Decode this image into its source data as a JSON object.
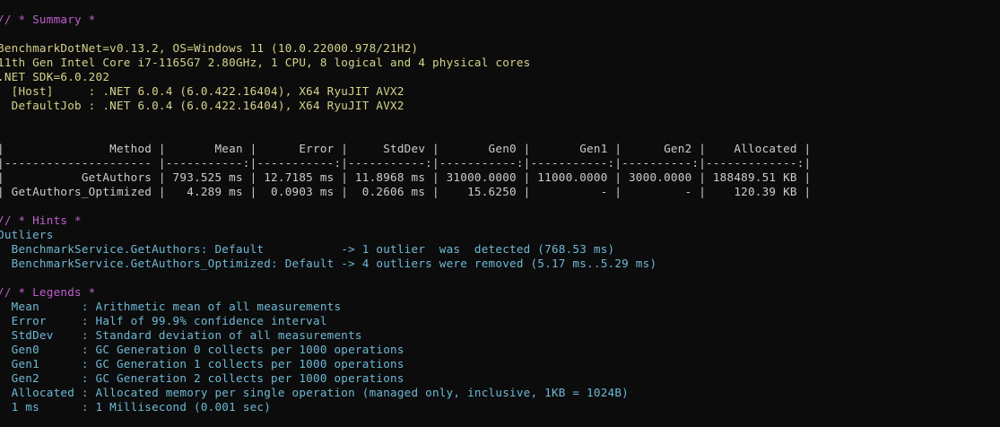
{
  "summary_header": "// * Summary *",
  "environment": {
    "line1": "BenchmarkDotNet=v0.13.2, OS=Windows 11 (10.0.22000.978/21H2)",
    "line2": "11th Gen Intel Core i7-1165G7 2.80GHz, 1 CPU, 8 logical and 4 physical cores",
    "line3": ".NET SDK=6.0.202",
    "line4": "  [Host]     : .NET 6.0.4 (6.0.422.16404), X64 RyuJIT AVX2",
    "line5": "  DefaultJob : .NET 6.0.4 (6.0.422.16404), X64 RyuJIT AVX2"
  },
  "results_table": {
    "header_row": "|               Method |       Mean |      Error |     StdDev |       Gen0 |       Gen1 |      Gen2 |    Allocated |",
    "separator_row": "|--------------------- |-----------:|-----------:|-----------:|-----------:|-----------:|----------:|-------------:|",
    "columns": [
      "Method",
      "Mean",
      "Error",
      "StdDev",
      "Gen0",
      "Gen1",
      "Gen2",
      "Allocated"
    ],
    "rows": [
      {
        "method": "GetAuthors",
        "mean": "793.525 ms",
        "error": "12.7185 ms",
        "stddev": "11.8968 ms",
        "gen0": "31000.0000",
        "gen1": "11000.0000",
        "gen2": "3000.0000",
        "allocated": "188489.51 KB",
        "text": "|           GetAuthors | 793.525 ms | 12.7185 ms | 11.8968 ms | 31000.0000 | 11000.0000 | 3000.0000 | 188489.51 KB |"
      },
      {
        "method": "GetAuthors_Optimized",
        "mean": "4.289 ms",
        "error": "0.0903 ms",
        "stddev": "0.2606 ms",
        "gen0": "15.6250",
        "gen1": "-",
        "gen2": "-",
        "allocated": "120.39 KB",
        "text": "| GetAuthors_Optimized |   4.289 ms |  0.0903 ms |  0.2606 ms |    15.6250 |          - |         - |    120.39 KB |"
      }
    ]
  },
  "hints_header": "// * Hints *",
  "hints": {
    "title": "Outliers",
    "line1": "  BenchmarkService.GetAuthors: Default           -> 1 outlier  was  detected (768.53 ms)",
    "line2": "  BenchmarkService.GetAuthors_Optimized: Default -> 4 outliers were removed (5.17 ms..5.29 ms)"
  },
  "legends_header": "// * Legends *",
  "legends": [
    "  Mean      : Arithmetic mean of all measurements",
    "  Error     : Half of 99.9% confidence interval",
    "  StdDev    : Standard deviation of all measurements",
    "  Gen0      : GC Generation 0 collects per 1000 operations",
    "  Gen1      : GC Generation 1 collects per 1000 operations",
    "  Gen2      : GC Generation 2 collects per 1000 operations",
    "  Allocated : Allocated memory per single operation (managed only, inclusive, 1KB = 1024B)",
    "  1 ms      : 1 Millisecond (0.001 sec)"
  ],
  "colors": {
    "background": "#0c0c0c",
    "section_header": "#c15fd0",
    "environment_text": "#d6d38c",
    "info_text": "#6fb9d6",
    "table_text": "#cccccc"
  }
}
